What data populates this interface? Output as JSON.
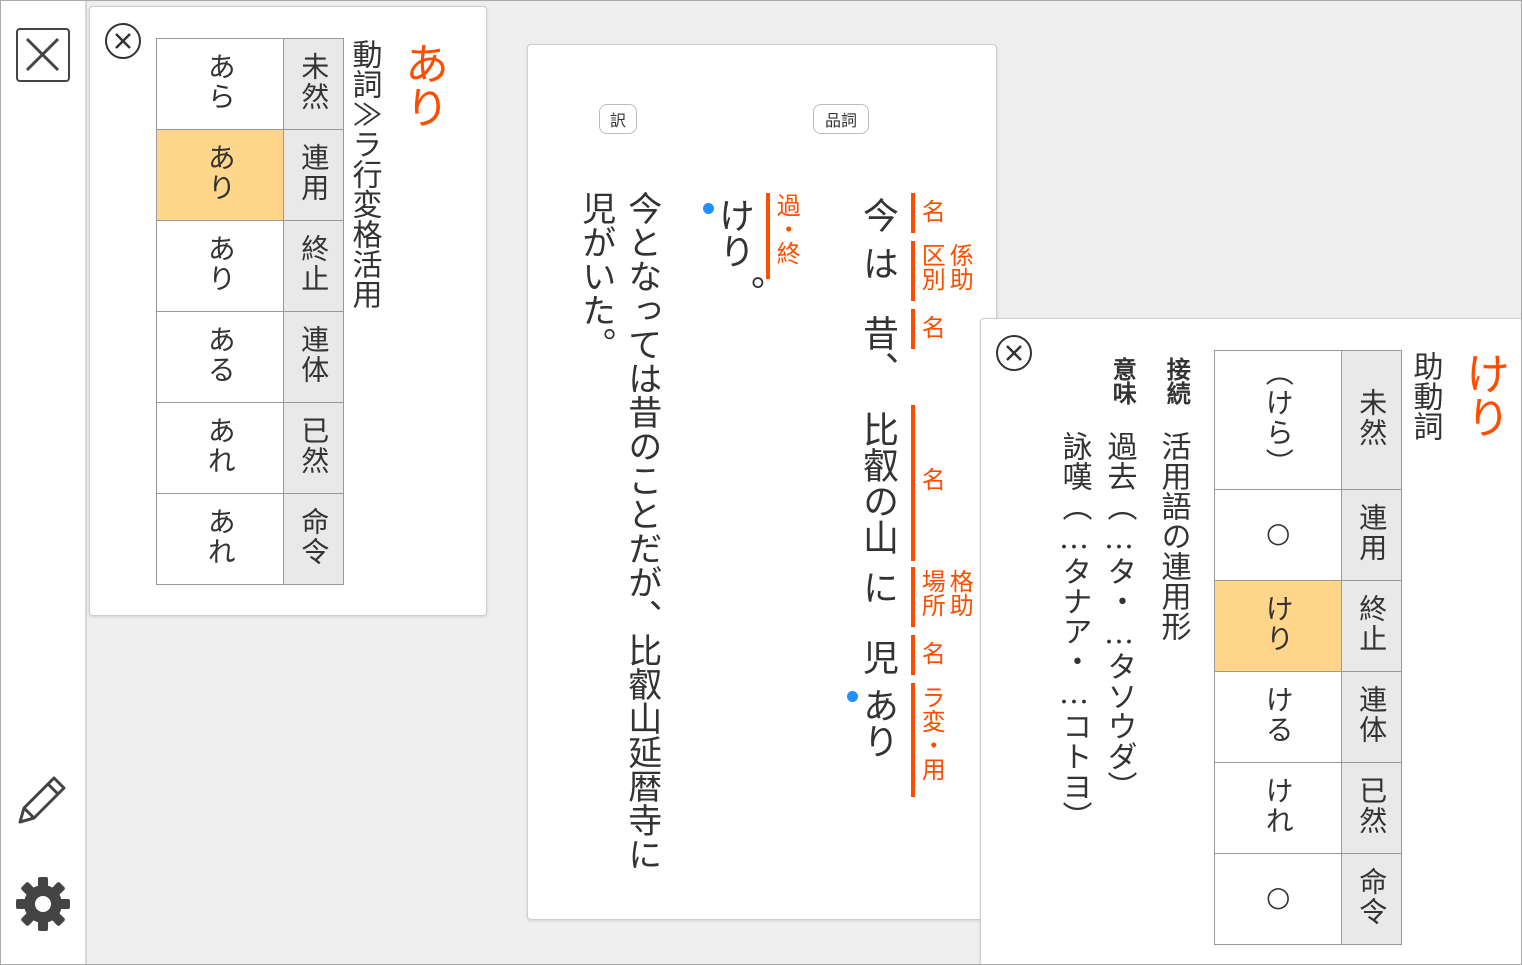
{
  "sidebar": {
    "close_icon": "close-icon",
    "pencil_icon": "pencil-icon",
    "gear_icon": "gear-icon"
  },
  "left_card": {
    "word": "あり",
    "pos": "動詞≫ラ行変格活用",
    "rows": [
      {
        "label": "未然",
        "form": "あら",
        "highlighted": false
      },
      {
        "label": "連用",
        "form": "あり",
        "highlighted": true
      },
      {
        "label": "終止",
        "form": "あり",
        "highlighted": false
      },
      {
        "label": "連体",
        "form": "ある",
        "highlighted": false
      },
      {
        "label": "已然",
        "form": "あれ",
        "highlighted": false
      },
      {
        "label": "命令",
        "form": "あれ",
        "highlighted": false
      }
    ]
  },
  "passage": {
    "translate_button": "訳",
    "pos_button": "品詞",
    "segments": [
      {
        "text": "今",
        "tag": "名"
      },
      {
        "text": "は",
        "tag_a": "区別",
        "tag_b": "係助"
      },
      {
        "text": "昔、",
        "tag": "名"
      },
      {
        "text": "比叡の山",
        "tag": "名"
      },
      {
        "text": "に",
        "tag_a": "場所",
        "tag_b": "格助"
      },
      {
        "text": "児",
        "tag": "名"
      },
      {
        "text": "あり",
        "tag": "ラ変・用"
      },
      {
        "text": "けり",
        "tag": "過・終"
      },
      {
        "text": "。"
      }
    ],
    "translation_line1": "今となっては昔のことだが、比叡山延暦寺に",
    "translation_line2": "児がいた。"
  },
  "right_card": {
    "word": "けり",
    "pos": "助動詞",
    "connection_label": "接続",
    "connection_text": "活用語の連用形",
    "meaning_label": "意味",
    "meaning_1": "過去（…タ・…タソウダ）",
    "meaning_2": "詠嘆（…タナア・…コトヨ）",
    "rows": [
      {
        "label": "未然",
        "form": "（けら）",
        "highlighted": false
      },
      {
        "label": "連用",
        "form": "○",
        "highlighted": false
      },
      {
        "label": "終止",
        "form": "けり",
        "highlighted": true
      },
      {
        "label": "連体",
        "form": "ける",
        "highlighted": false
      },
      {
        "label": "已然",
        "form": "けれ",
        "highlighted": false
      },
      {
        "label": "命令",
        "form": "○",
        "highlighted": false
      }
    ]
  },
  "colors": {
    "accent": "#ff4d00",
    "highlight": "#ffd68a",
    "label_bg": "#e9e9e9",
    "dot": "#1e90ff"
  }
}
